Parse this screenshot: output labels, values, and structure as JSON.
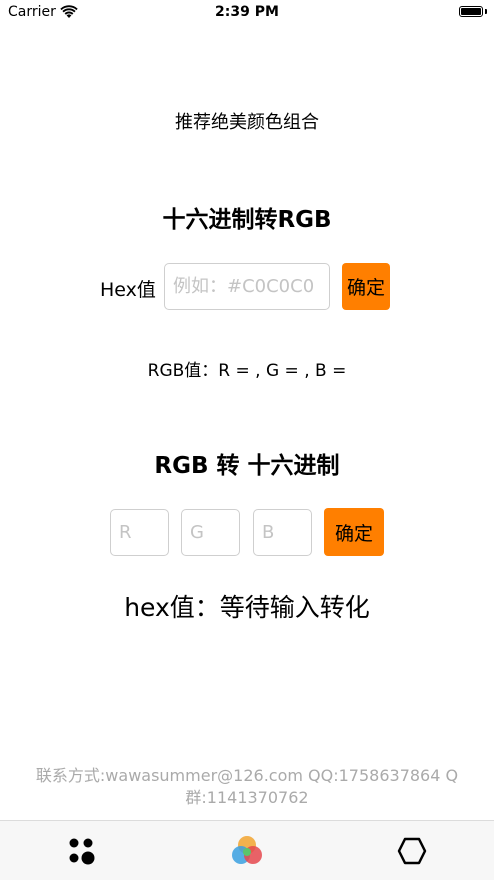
{
  "status_bar": {
    "carrier": "Carrier",
    "time": "2:39 PM"
  },
  "recommend_link": "推荐绝美颜色组合",
  "hex_to_rgb": {
    "title": "十六进制转RGB",
    "hex_label": "Hex值",
    "hex_placeholder": "例如：#C0C0C0",
    "confirm_label": "确定",
    "result_text": "RGB值：R = ,    G = ,    B ="
  },
  "rgb_to_hex": {
    "title": "RGB 转 十六进制",
    "r_placeholder": "R",
    "g_placeholder": "G",
    "b_placeholder": "B",
    "confirm_label": "确定",
    "result_text": "hex值：等待输入转化"
  },
  "contact": "联系方式:wawasummer@126.com QQ:1758637864 Q群:1141370762",
  "tab_bar": {
    "tabs": [
      {
        "icon": "dots-icon"
      },
      {
        "icon": "color-circles-icon"
      },
      {
        "icon": "hexagon-icon"
      }
    ]
  },
  "colors": {
    "accent": "#ff7f00",
    "contact_text": "#aaaaaa",
    "input_border": "#cfcfcf",
    "placeholder": "#c4c4c4"
  }
}
